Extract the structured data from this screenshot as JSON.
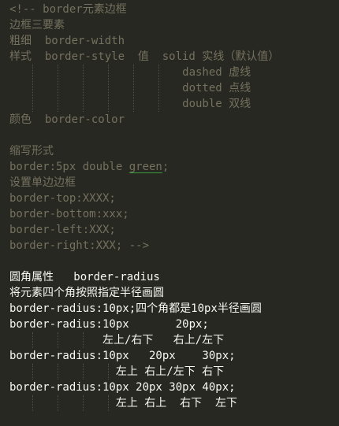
{
  "lines": [
    {
      "style": "comment",
      "text": "<!-- border元素边框"
    },
    {
      "style": "comment",
      "text": "边框三要素"
    },
    {
      "style": "comment",
      "text": "粗细  border-width"
    },
    {
      "style": "comment",
      "text": "样式  border-style  值  solid 实线（默认值）"
    },
    {
      "style": "comment",
      "text": "                          dashed 虚线"
    },
    {
      "style": "comment",
      "text": "                          dotted 点线"
    },
    {
      "style": "comment",
      "text": "                          double 双线"
    },
    {
      "style": "comment",
      "text": "颜色  border-color"
    },
    {
      "style": "comment",
      "text": ""
    },
    {
      "style": "comment",
      "text": "缩写形式"
    },
    {
      "style": "comment",
      "text": "border:5px double ",
      "underlined": "green",
      "after": ";"
    },
    {
      "style": "comment",
      "text": "设置单边边框"
    },
    {
      "style": "comment",
      "text": "border-top:XXXX;"
    },
    {
      "style": "comment",
      "text": "border-bottom:xxx;"
    },
    {
      "style": "comment",
      "text": "border-left:XXX;"
    },
    {
      "style": "comment",
      "text": "border-right:XXX; -->"
    },
    {
      "style": "plain",
      "text": ""
    },
    {
      "style": "plain",
      "text": "圆角属性   border-radius"
    },
    {
      "style": "plain",
      "text": "将元素四个角按照指定半径画圆"
    },
    {
      "style": "plain",
      "text": "border-radius:10px;四个角都是10px半径画圆"
    },
    {
      "style": "plain",
      "text": "border-radius:10px       20px;"
    },
    {
      "style": "plain",
      "text": "              左上/右下   右上/左下"
    },
    {
      "style": "plain",
      "text": "border-radius:10px   20px    30px;"
    },
    {
      "style": "plain",
      "text": "                左上 右上/左下 右下"
    },
    {
      "style": "plain",
      "text": "border-radius:10px 20px 30px 40px;"
    },
    {
      "style": "plain",
      "text": "                左上 右上  右下  左下"
    }
  ]
}
